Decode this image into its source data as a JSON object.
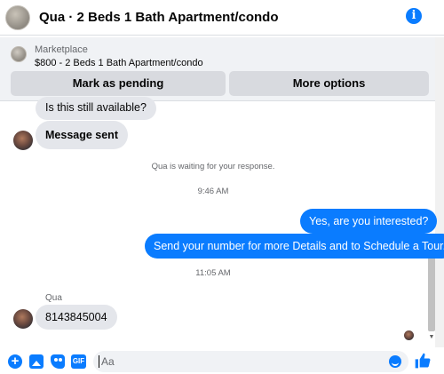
{
  "header": {
    "title": "Qua · 2 Beds 1 Bath Apartment/condo",
    "info_icon": "info-icon"
  },
  "marketplace": {
    "label": "Marketplace",
    "listing": "$800 - 2 Beds 1 Bath Apartment/condo",
    "pending_button": "Mark as pending",
    "more_button": "More options"
  },
  "messages": {
    "m1": "Is this still available?",
    "m2": "Message sent",
    "waiting": "Qua is waiting for your response.",
    "time1": "9:46 AM",
    "m3": "Yes, are you interested?",
    "m4": "Send your number for more Details and to Schedule a Tour.",
    "time2": "11:05 AM",
    "sender": "Qua",
    "m5": "8143845004"
  },
  "composer": {
    "placeholder": "Aa",
    "icons": [
      "plus-icon",
      "photo-icon",
      "sticker-icon",
      "gif-icon",
      "emoji-icon",
      "thumbs-up-icon"
    ]
  },
  "colors": {
    "accent": "#0a7cff",
    "incoming_bubble": "#e4e6eb",
    "panel": "#f0f2f5"
  }
}
